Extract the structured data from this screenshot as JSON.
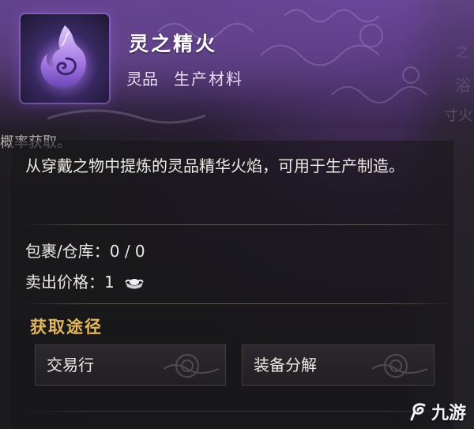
{
  "item": {
    "name": "灵之精火",
    "grade": "灵品",
    "type": "生产材料",
    "icon": "purple-spirit-flame-icon"
  },
  "overlap_text": "概率获取。",
  "description": "从穿戴之物中提炼的灵品精华火焰，可用于生产制造。",
  "inventory": {
    "label": "包裹/仓库：",
    "value": "0 / 0"
  },
  "sell_price": {
    "label": "卖出价格：",
    "value": "1",
    "currency_icon": "silver-ingot-icon"
  },
  "acquire": {
    "title": "获取途径",
    "sources": [
      {
        "label": "交易行"
      },
      {
        "label": "装备分解"
      }
    ]
  },
  "background_glyphs": [
    "浴",
    "寸火",
    "之"
  ],
  "watermark": {
    "text": "九游",
    "icon": "jiuyou-logo-icon"
  },
  "colors": {
    "header_purple": "#7a50aa",
    "section_title_gold": "#e2b65c",
    "text": "#ece8e2"
  }
}
